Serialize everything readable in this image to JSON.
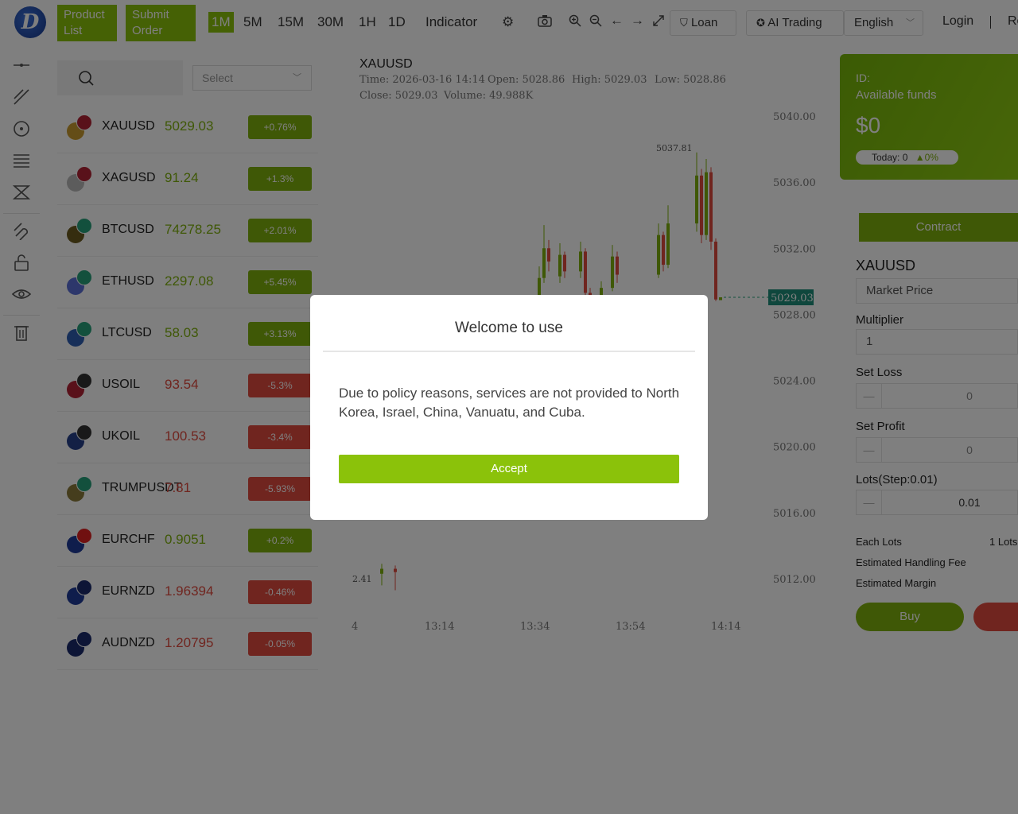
{
  "header": {
    "product_list": "Product List",
    "submit_order": "Submit Order",
    "timeframes": [
      "1M",
      "5M",
      "15M",
      "30M",
      "1H",
      "1D"
    ],
    "indicator": "Indicator",
    "loan": "Loan",
    "ai_trading": "AI Trading",
    "language": "English",
    "login": "Login",
    "register_partial": "Re"
  },
  "products": {
    "search_placeholder": "",
    "select_placeholder": "Select",
    "items": [
      {
        "symbol": "XAUUSD",
        "price": "5029.03",
        "change": "+0.76%",
        "dir": "up",
        "c1": "#c99a2e",
        "c2": "#b22234"
      },
      {
        "symbol": "XAGUSD",
        "price": "91.24",
        "change": "+1.3%",
        "dir": "up",
        "c1": "#b8b8b8",
        "c2": "#b22234"
      },
      {
        "symbol": "BTCUSD",
        "price": "74278.25",
        "change": "+2.01%",
        "dir": "up",
        "c1": "#6b5a1f",
        "c2": "#26a17b"
      },
      {
        "symbol": "ETHUSD",
        "price": "2297.08",
        "change": "+5.45%",
        "dir": "up",
        "c1": "#5a6fd6",
        "c2": "#26a17b"
      },
      {
        "symbol": "LTCUSD",
        "price": "58.03",
        "change": "+3.13%",
        "dir": "up",
        "c1": "#2f5fb3",
        "c2": "#26a17b"
      },
      {
        "symbol": "USOIL",
        "price": "93.54",
        "change": "-5.3%",
        "dir": "down",
        "c1": "#b22234",
        "c2": "#333333"
      },
      {
        "symbol": "UKOIL",
        "price": "100.53",
        "change": "-3.4%",
        "dir": "down",
        "c1": "#27408b",
        "c2": "#333333"
      },
      {
        "symbol": "TRUMPUSDT",
        "price": "7.81",
        "change": "-5.93%",
        "dir": "down",
        "c1": "#8a7a3a",
        "c2": "#26a17b"
      },
      {
        "symbol": "EURCHF",
        "price": "0.9051",
        "change": "+0.2%",
        "dir": "up",
        "c1": "#1f3b99",
        "c2": "#e02020"
      },
      {
        "symbol": "EURNZD",
        "price": "1.96394",
        "change": "-0.46%",
        "dir": "down",
        "c1": "#1f3b99",
        "c2": "#1a2a6c"
      },
      {
        "symbol": "AUDNZD",
        "price": "1.20795",
        "change": "-0.05%",
        "dir": "down",
        "c1": "#1a2a6c",
        "c2": "#1a2a6c"
      }
    ]
  },
  "chart": {
    "symbol": "XAUUSD",
    "time": "Time: 2026-03-16 14:14",
    "open": "Open: 5028.86",
    "high": "High: 5029.03",
    "low": "Low: 5028.86",
    "close": "Close: 5029.03",
    "volume": "Volume: 49.988K",
    "y_ticks": [
      "5040.00",
      "5036.00",
      "5032.00",
      "5028.00",
      "5024.00",
      "5020.00",
      "5016.00",
      "5012.00"
    ],
    "x_ticks": [
      "4",
      "13:14",
      "13:34",
      "13:54",
      "14:14"
    ],
    "high_marker": "5037.81",
    "low_marker": "2.41",
    "last_price": "5029.03"
  },
  "chart_data": {
    "type": "candlestick",
    "ylim": [
      5010,
      5042
    ],
    "y_ticks": [
      5040,
      5036,
      5032,
      5028,
      5024,
      5020,
      5016,
      5012
    ],
    "x_ticks": [
      "13:14",
      "13:34",
      "13:54",
      "14:14"
    ],
    "candles": [
      {
        "o": 5012.3,
        "c": 5012.6,
        "h": 5012.9,
        "l": 5011.6
      },
      {
        "o": 5012.6,
        "c": 5012.4,
        "h": 5012.8,
        "l": 5011.3
      },
      {
        "o": 5028.1,
        "c": 5028.4,
        "h": 5028.7,
        "l": 5027.9
      },
      {
        "o": 5028.4,
        "c": 5028.0,
        "h": 5028.6,
        "l": 5027.8
      },
      {
        "o": 5028.0,
        "c": 5030.2,
        "h": 5030.9,
        "l": 5027.8
      },
      {
        "o": 5030.2,
        "c": 5032.0,
        "h": 5033.4,
        "l": 5029.9
      },
      {
        "o": 5032.0,
        "c": 5031.2,
        "h": 5032.5,
        "l": 5030.6
      },
      {
        "o": 5030.3,
        "c": 5031.6,
        "h": 5032.3,
        "l": 5029.9
      },
      {
        "o": 5031.6,
        "c": 5030.6,
        "h": 5031.8,
        "l": 5030.2
      },
      {
        "o": 5030.6,
        "c": 5031.8,
        "h": 5032.4,
        "l": 5030.2
      },
      {
        "o": 5031.8,
        "c": 5029.3,
        "h": 5032.0,
        "l": 5028.9
      },
      {
        "o": 5029.3,
        "c": 5028.7,
        "h": 5029.6,
        "l": 5028.4
      },
      {
        "o": 5028.7,
        "c": 5029.6,
        "h": 5030.0,
        "l": 5028.5
      },
      {
        "o": 5029.6,
        "c": 5031.5,
        "h": 5032.2,
        "l": 5029.4
      },
      {
        "o": 5031.5,
        "c": 5030.4,
        "h": 5031.8,
        "l": 5029.9
      },
      {
        "o": 5030.4,
        "c": 5032.8,
        "h": 5033.5,
        "l": 5030.2
      },
      {
        "o": 5032.8,
        "c": 5031.0,
        "h": 5033.0,
        "l": 5030.6
      },
      {
        "o": 5031.0,
        "c": 5033.5,
        "h": 5034.6,
        "l": 5030.8
      },
      {
        "o": 5033.5,
        "c": 5036.4,
        "h": 5037.8,
        "l": 5033.0
      },
      {
        "o": 5036.4,
        "c": 5032.8,
        "h": 5036.8,
        "l": 5032.3
      },
      {
        "o": 5032.8,
        "c": 5036.6,
        "h": 5037.4,
        "l": 5032.5
      },
      {
        "o": 5036.6,
        "c": 5032.4,
        "h": 5036.9,
        "l": 5031.9
      },
      {
        "o": 5032.4,
        "c": 5028.9,
        "h": 5032.6,
        "l": 5028.8
      },
      {
        "o": 5028.86,
        "c": 5029.03,
        "h": 5029.03,
        "l": 5028.86
      }
    ]
  },
  "right": {
    "id_label": "ID:",
    "funds_label": "Available funds",
    "amount": "$0",
    "today": "Today: 0",
    "today_pct": "0%",
    "contract": "Contract",
    "symbol": "XAUUSD",
    "market_price": "Market Price",
    "multiplier_label": "Multiplier",
    "multiplier": "1",
    "set_loss": "Set Loss",
    "loss_val": "0",
    "set_profit": "Set Profit",
    "profit_val": "0",
    "lots_label": "Lots(Step:0.01)",
    "lots_val": "0.01",
    "each_lots": "Each Lots",
    "each_lots_val": "1 Lots",
    "handling_fee": "Estimated Handling Fee",
    "margin": "Estimated Margin",
    "buy": "Buy"
  },
  "modal": {
    "title": "Welcome to use",
    "message": "Due to policy reasons, services are not provided to North Korea, Israel, China, Vanuatu, and Cuba.",
    "accept": "Accept"
  },
  "colors": {
    "accent": "#8bc20a",
    "up": "#7fb10d",
    "down": "#e04a3f"
  }
}
